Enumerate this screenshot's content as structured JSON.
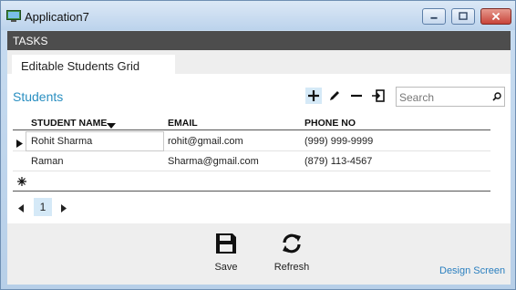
{
  "window": {
    "title": "Application7"
  },
  "tasks": {
    "label": "TASKS"
  },
  "tabs": [
    {
      "label": "Editable Students Grid"
    }
  ],
  "section": {
    "title": "Students"
  },
  "search": {
    "placeholder": "Search",
    "value": ""
  },
  "toolbar": {
    "icons": [
      "add-icon",
      "edit-icon",
      "remove-icon",
      "export-icon"
    ]
  },
  "grid": {
    "columns": [
      "STUDENT NAME",
      "EMAIL",
      "PHONE NO"
    ],
    "sorted_column": "STUDENT NAME",
    "rows": [
      {
        "name": "Rohit Sharma",
        "email": "rohit@gmail.com",
        "phone": "(999) 999-9999"
      },
      {
        "name": "Raman",
        "email": "Sharma@gmail.com",
        "phone": "(879) 113-4567"
      }
    ]
  },
  "pager": {
    "current_page": "1"
  },
  "actions": {
    "save": "Save",
    "refresh": "Refresh"
  },
  "footer": {
    "design_screen": "Design Screen"
  },
  "colors": {
    "accent": "#2a8fc1",
    "tasks_bar": "#4d4d4d",
    "selected": "#d5e9f7"
  }
}
